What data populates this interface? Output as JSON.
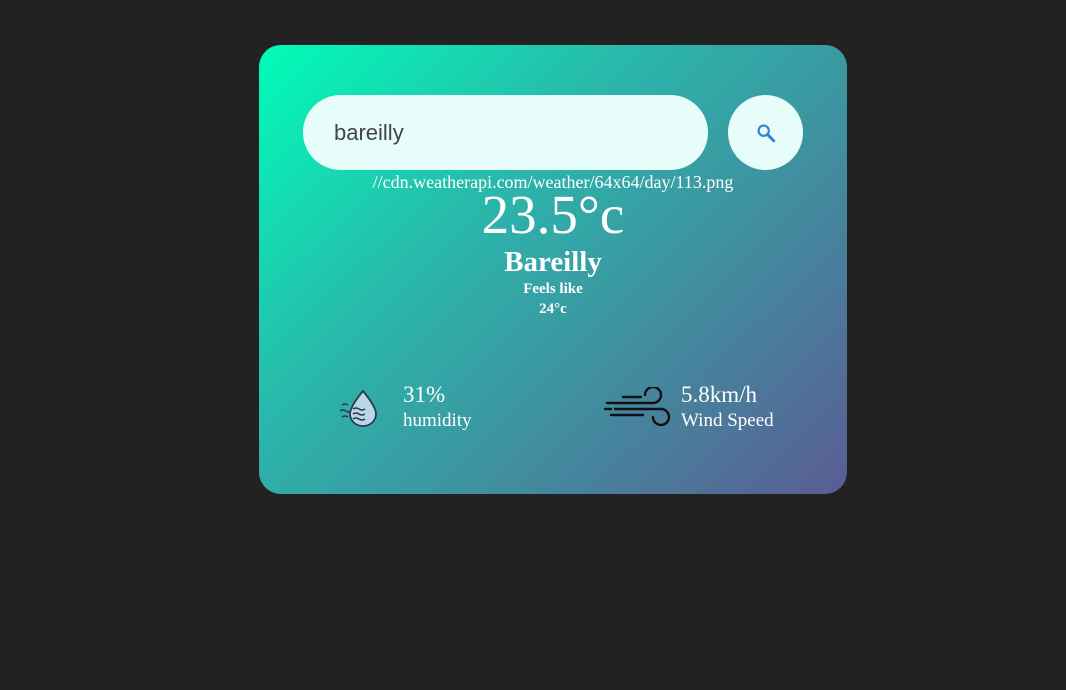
{
  "search": {
    "value": "bareilly",
    "button_icon": "search-icon"
  },
  "weather": {
    "icon_url": "//cdn.weatherapi.com/weather/64x64/day/113.png",
    "temperature": "23.5°c",
    "city": "Bareilly",
    "feels_like_label": "Feels like",
    "feels_like_value": "24°c"
  },
  "details": {
    "humidity": {
      "icon": "humidity-icon",
      "value": "31%",
      "label": "humidity"
    },
    "wind": {
      "icon": "wind-icon",
      "value": "5.8km/h",
      "label": "Wind Speed"
    }
  },
  "colors": {
    "page_background": "#222222",
    "gradient_start": "#00fdb8",
    "gradient_end": "#5a5c94",
    "input_background": "#e6fdfa",
    "search_icon": "#2e86d4",
    "text": "#ffffff"
  }
}
